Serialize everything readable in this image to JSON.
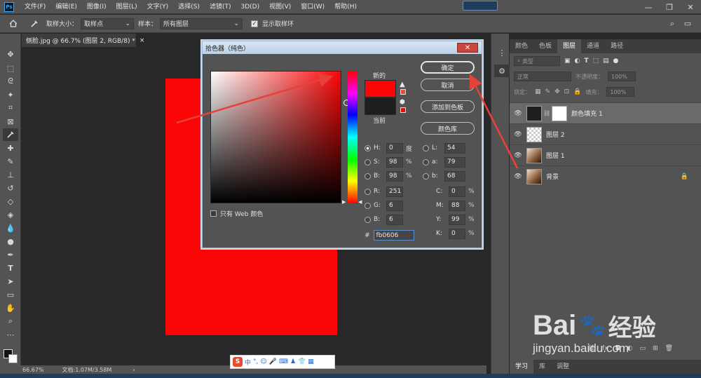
{
  "app": {
    "logo": "Ps"
  },
  "menu": [
    "文件(F)",
    "编辑(E)",
    "图像(I)",
    "图层(L)",
    "文字(Y)",
    "选择(S)",
    "滤镜(T)",
    "3D(D)",
    "视图(V)",
    "窗口(W)",
    "帮助(H)"
  ],
  "window_controls": {
    "minimize": "—",
    "restore": "❐",
    "close": "✕"
  },
  "options": {
    "sample_size_label": "取样大小：",
    "sample_size_value": "取样点",
    "sample_label": "样本：",
    "sample_value": "所有图层",
    "show_ring_label": "显示取样环"
  },
  "document": {
    "tab_title": "侧脸.jpg @ 66.7% (图层 2, RGB/8) *",
    "tab_close": "×",
    "fill_color": "#fb0606"
  },
  "status": {
    "zoom": "66.67%",
    "doc_info": "文档:1.07M/3.58M"
  },
  "dialog": {
    "title": "拾色器（纯色）",
    "close": "✕",
    "new_label": "新的",
    "current_label": "当前",
    "ok": "确定",
    "cancel": "取消",
    "add_to_swatches": "添加到色板",
    "color_libraries": "颜色库",
    "web_only": "只有 Web 颜色",
    "hsb": {
      "H": "0",
      "H_unit": "度",
      "S": "98",
      "S_unit": "%",
      "B": "98",
      "B_unit": "%"
    },
    "rgb": {
      "R": "251",
      "G": "6",
      "B": "6"
    },
    "lab": {
      "L": "54",
      "a": "79",
      "b": "68"
    },
    "cmyk": {
      "C": "0",
      "M": "88",
      "Y": "99",
      "K": "0",
      "unit": "%"
    },
    "hex_label": "#",
    "hex": "fb0606",
    "new_color": "#fb0606",
    "current_color": "#1e1e1e",
    "selected_hue_deg": 0
  },
  "panel": {
    "tabs": [
      "颜色",
      "色板",
      "图层",
      "通道",
      "路径"
    ],
    "active_tab": "图层",
    "filter_placeholder": "类型",
    "blend_mode": "正常",
    "opacity_label": "不透明度：",
    "opacity_value": "100%",
    "lock_label": "锁定：",
    "fill_label": "填充：",
    "fill_value": "100%",
    "layers": [
      {
        "name": "颜色填充 1",
        "selected": true
      },
      {
        "name": "图层 2",
        "selected": false
      },
      {
        "name": "图层 1",
        "selected": false
      },
      {
        "name": "背景",
        "selected": false,
        "locked": true
      }
    ],
    "bottom_tabs": [
      "学习",
      "库",
      "调整"
    ]
  },
  "ime": {
    "brand": "S",
    "lang": "中",
    "punct": "°,"
  },
  "watermark": {
    "brand": "Bai",
    "brand2": "经验",
    "url": "jingyan.baidu.com"
  }
}
